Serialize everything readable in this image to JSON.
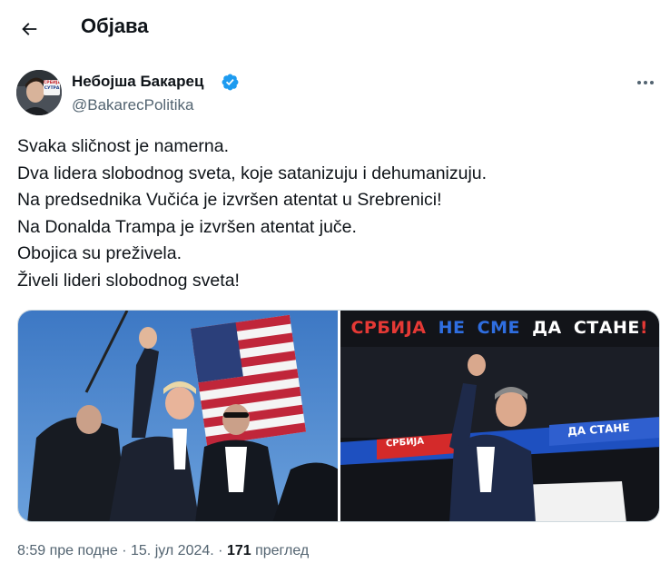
{
  "header": {
    "title": "Објава",
    "back_icon": "arrow-left-icon"
  },
  "author": {
    "name": "Небојша Бакарец",
    "handle": "@BakarecPolitika",
    "verified_color": "#1d9bf0",
    "avatar_badge_line1": "СРБИЈА",
    "avatar_badge_line2": "СУТРА"
  },
  "tweet": {
    "lines": [
      "Svaka sličnost je namerna.",
      "Dva lidera slobodnog sveta, koje satanizuju i dehumanizuju.",
      "Na predsednika Vučića je izvršen atentat u Srebrenici!",
      "Na Donalda Trampa je izvršen atentat juče.",
      "Obojica su preživela.",
      "Živeli lideri slobodnog sveta!"
    ]
  },
  "media": {
    "right_banner": {
      "w1": "СРБИЈА",
      "w2": "НЕ",
      "w3": "СМЕ",
      "w4": "ДА",
      "w5": "СТАНЕ",
      "w6": "!"
    },
    "stage_text_1": "СРБИЈА",
    "stage_text_2": "ДА СТАНЕ"
  },
  "meta": {
    "time": "8:59 пре подне",
    "separator1": " · ",
    "date": "15. јул 2024.",
    "separator2": " · ",
    "views_count": "171",
    "views_label": " преглед"
  }
}
